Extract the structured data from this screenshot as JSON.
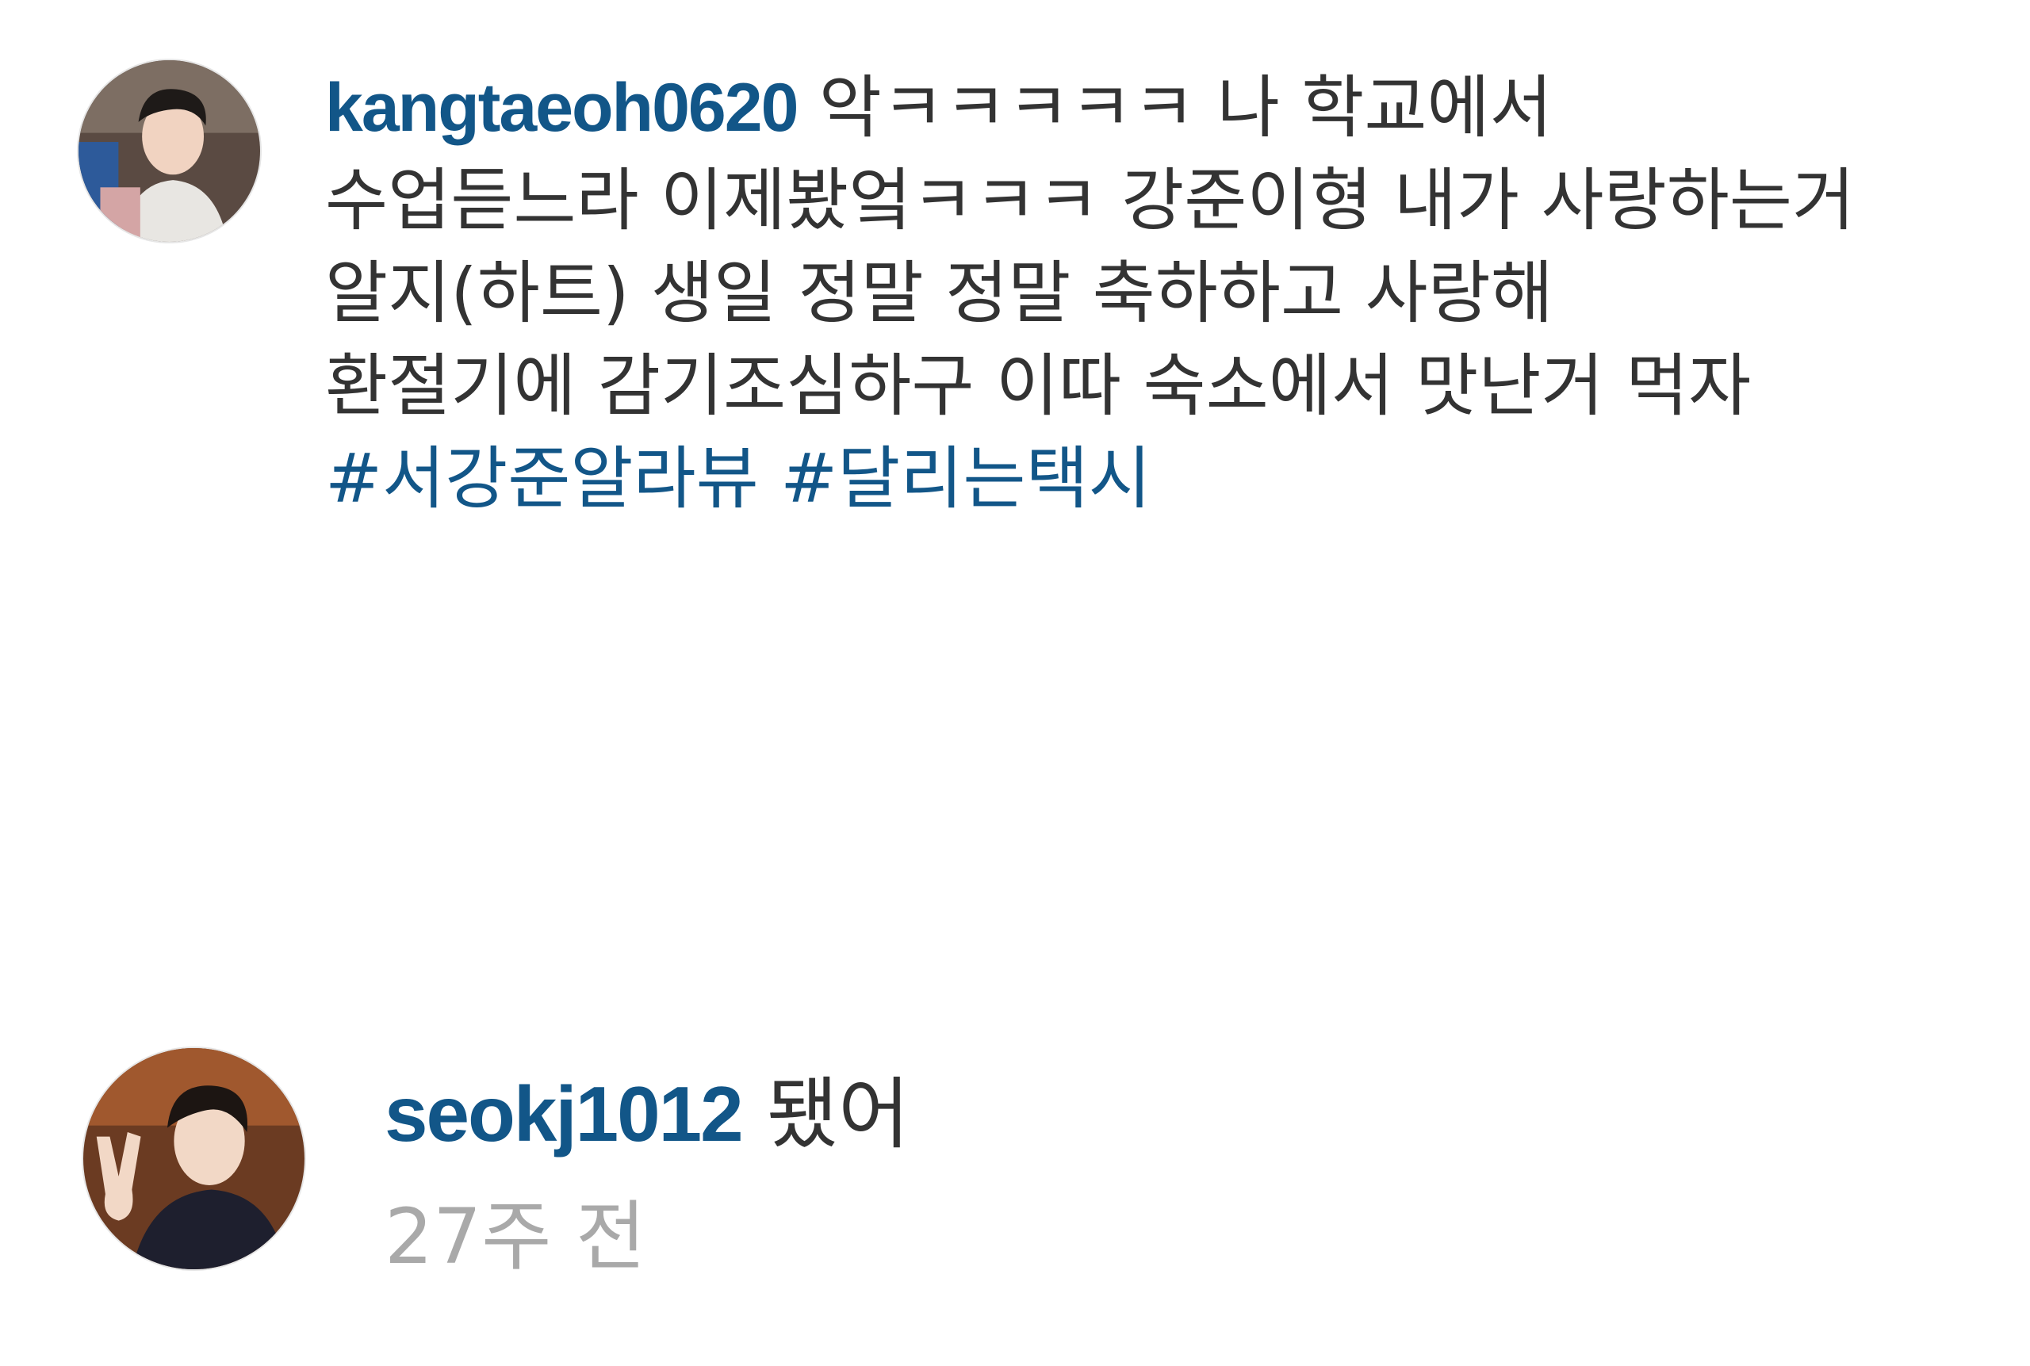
{
  "comments": [
    {
      "username": "kangtaeoh0620",
      "avatar": "profile-photo",
      "lines": [
        "악ㅋㅋㅋㅋㅋ 나 학교에서",
        "수업듣느라 이제봤엌ㅋㅋㅋ 강준이형 내가 사랑하는거",
        "알지(하트) 생일 정말 정말 축하하고 사랑해",
        "환절기에 감기조심하구 이따 숙소에서 맛난거 먹자"
      ],
      "hashtags": [
        "#서강준알라뷰",
        "#달리는택시"
      ]
    },
    {
      "username": "seokj1012",
      "avatar": "profile-photo",
      "text": "됐어",
      "timestamp": "27주 전"
    }
  ],
  "colors": {
    "username": "#125688",
    "hashtag": "#125688",
    "text": "#333333",
    "timestamp": "#a9a9a9"
  }
}
